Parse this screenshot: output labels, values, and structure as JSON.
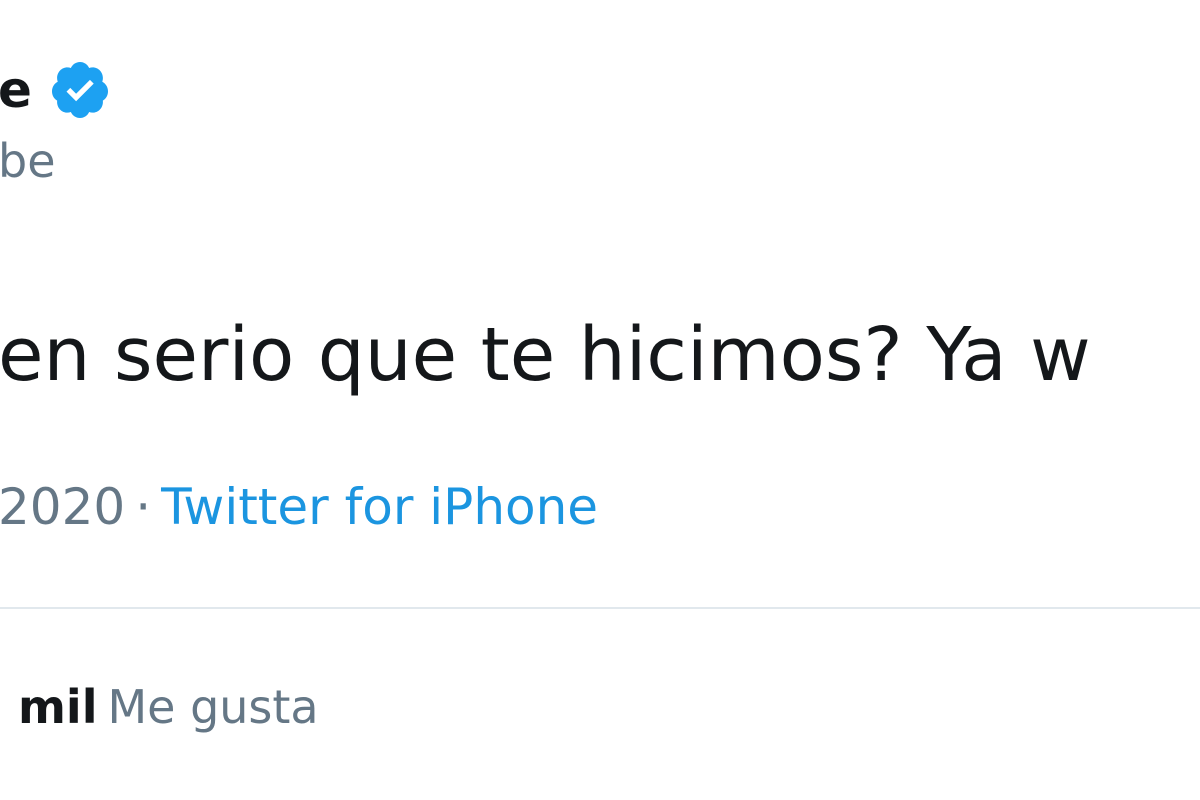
{
  "tweet": {
    "author_name_visible": "e",
    "handle_visible": "be",
    "text_visible": "en serio que te hicimos? Ya w",
    "date_visible": "2020",
    "separator": "·",
    "source": "Twitter for iPhone",
    "likes_count_visible": "mil",
    "likes_label": "Me gusta"
  },
  "colors": {
    "verified_badge": "#1da1f2",
    "link": "#1b95e0",
    "secondary_text": "#657786",
    "primary_text": "#14171a",
    "divider": "#e1e8ed"
  },
  "icons": {
    "verified": "verified-badge-icon"
  }
}
